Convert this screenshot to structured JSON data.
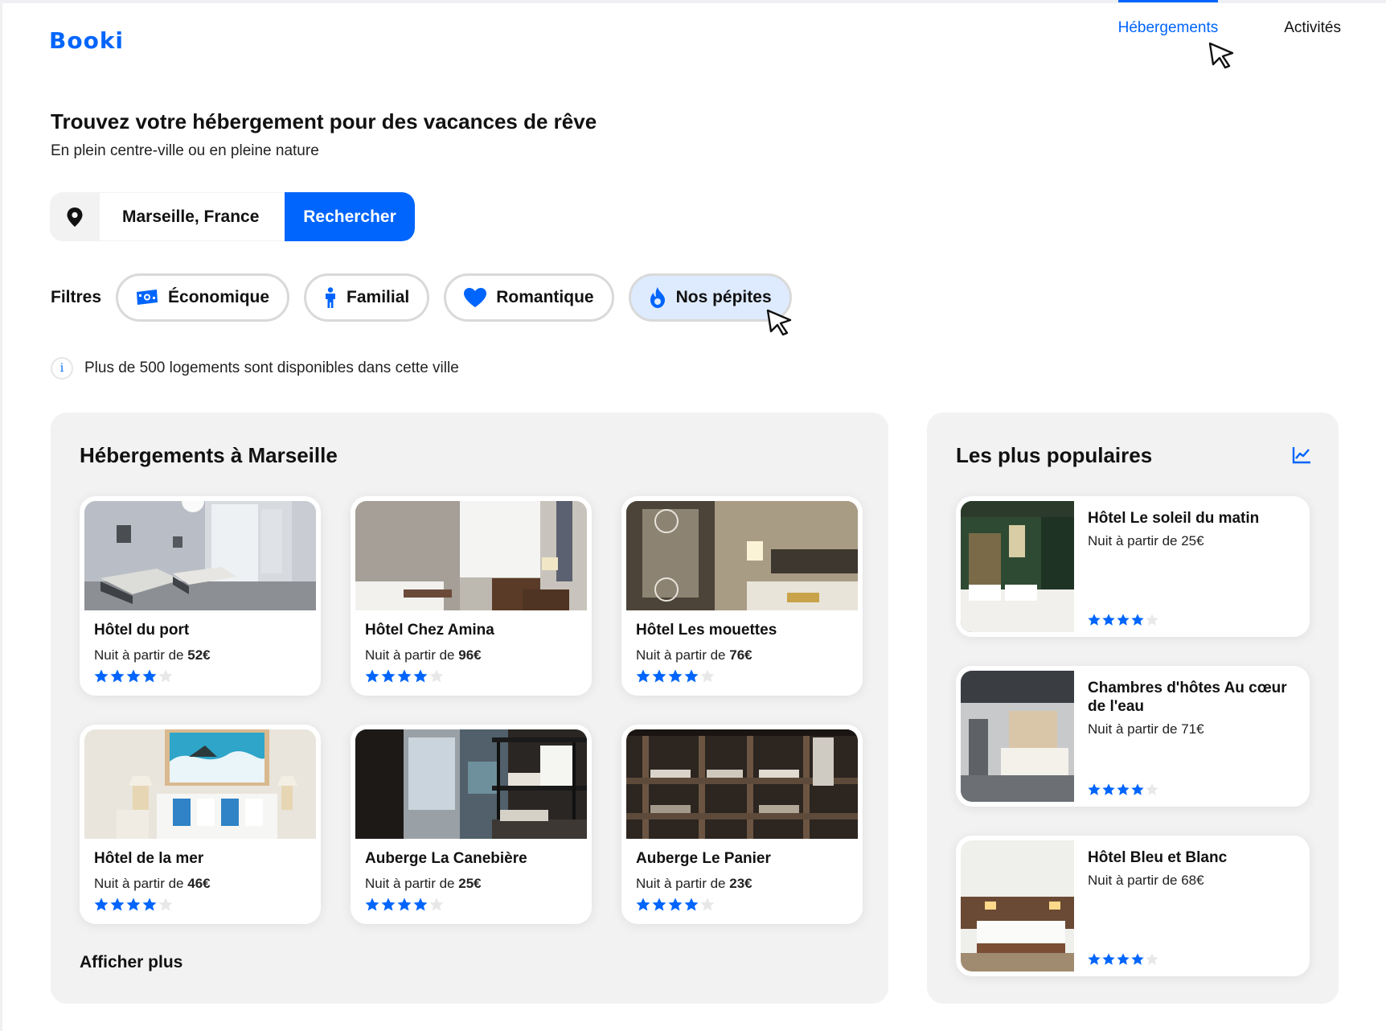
{
  "brand": {
    "logo": "Booki"
  },
  "nav": {
    "items": [
      {
        "label": "Hébergements",
        "active": true
      },
      {
        "label": "Activités",
        "active": false
      }
    ]
  },
  "hero": {
    "title": "Trouvez votre hébergement pour des vacances de rêve",
    "subtitle": "En plein centre-ville ou en pleine nature"
  },
  "search": {
    "value": "Marseille, France",
    "button_label": "Rechercher",
    "icon": "location-pin-icon"
  },
  "filters": {
    "label": "Filtres",
    "items": [
      {
        "label": "Économique",
        "icon": "money-icon",
        "active": false
      },
      {
        "label": "Familial",
        "icon": "person-icon",
        "active": false
      },
      {
        "label": "Romantique",
        "icon": "heart-icon",
        "active": false
      },
      {
        "label": "Nos pépites",
        "icon": "fire-icon",
        "active": true
      }
    ]
  },
  "info": {
    "text": "Plus de 500 logements sont disponibles dans cette ville",
    "icon": "info-icon"
  },
  "listings": {
    "title": "Hébergements à Marseille",
    "price_prefix": "Nuit à partir de",
    "items": [
      {
        "name": "Hôtel du port",
        "price": "Nuit à partir de ",
        "amount": "52€",
        "rating": 4
      },
      {
        "name": "Hôtel Chez Amina",
        "price": "Nuit à partir de ",
        "amount": "96€",
        "rating": 4
      },
      {
        "name": "Hôtel Les mouettes",
        "price": "Nuit à partir de ",
        "amount": "76€",
        "rating": 4
      },
      {
        "name": "Hôtel de la mer",
        "price": "Nuit à partir de ",
        "amount": "46€",
        "rating": 4
      },
      {
        "name": "Auberge La Canebière",
        "price": "Nuit à partir de ",
        "amount": "25€",
        "rating": 4
      },
      {
        "name": "Auberge Le Panier",
        "price": "Nuit à partir de ",
        "amount": "23€",
        "rating": 4
      }
    ],
    "more_label": "Afficher plus"
  },
  "popular": {
    "title": "Les plus populaires",
    "icon": "trending-icon",
    "items": [
      {
        "name": "Hôtel Le soleil du matin",
        "price": "Nuit à partir de 25€",
        "rating": 4
      },
      {
        "name": "Chambres d'hôtes Au cœur de l'eau",
        "price": "Nuit à partir de 71€",
        "rating": 4
      },
      {
        "name": "Hôtel Bleu et Blanc",
        "price": "Nuit à partir de 68€",
        "rating": 4
      }
    ]
  },
  "colors": {
    "accent": "#0065fc",
    "chip_active": "#deebff",
    "panel": "#f2f2f2",
    "star_empty": "#e8e8e8"
  }
}
